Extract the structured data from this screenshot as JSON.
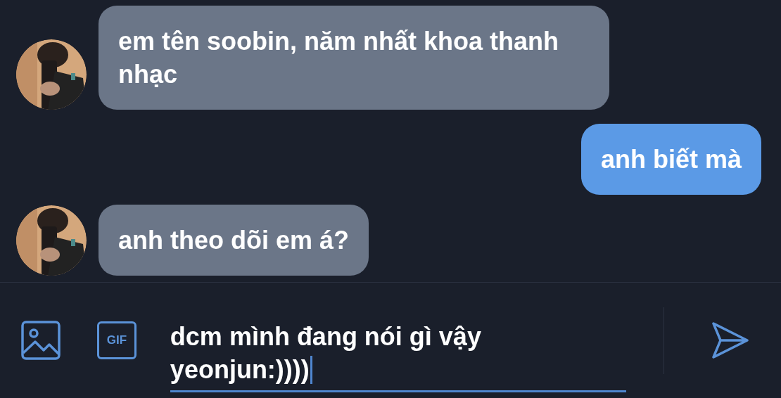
{
  "messages": [
    {
      "kind": "incoming",
      "text": "em tên soobin, năm nhất khoa thanh nhạc"
    },
    {
      "kind": "outgoing",
      "text": "anh biết mà"
    },
    {
      "kind": "incoming",
      "text": "anh theo dõi em á?"
    }
  ],
  "composer": {
    "gif_label": "GIF",
    "value": "dcm mình đang nói gì vậy yeonjun:))))"
  }
}
